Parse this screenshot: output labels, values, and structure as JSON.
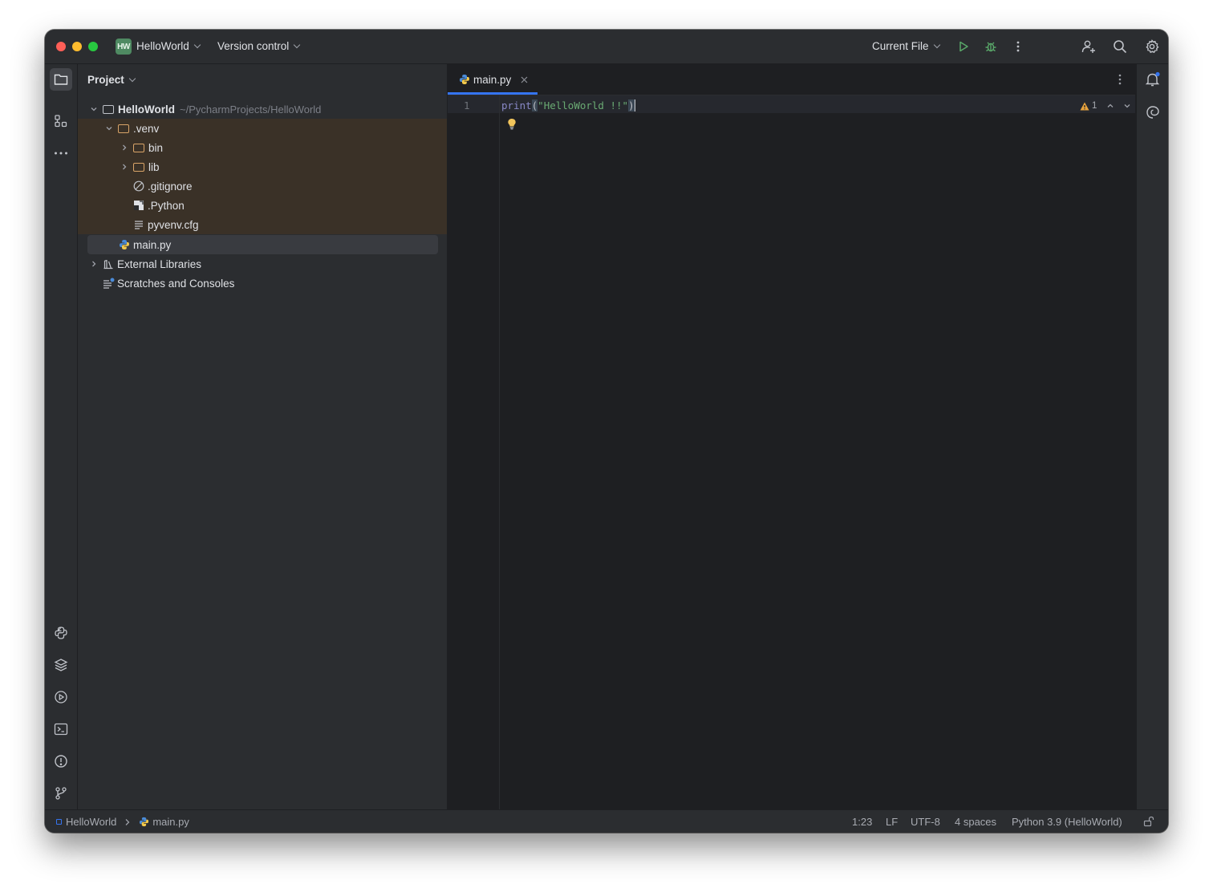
{
  "titlebar": {
    "project_badge": "HW",
    "project_name": "HelloWorld",
    "vcs_label": "Version control",
    "run_config": "Current File"
  },
  "left_tools": [
    "project-folder-icon",
    "structure-icon",
    "more-icon",
    "python-console-icon",
    "python-packages-icon",
    "services-icon",
    "terminal-icon",
    "problems-icon",
    "git-icon"
  ],
  "project_panel": {
    "title": "Project",
    "tree": {
      "root": {
        "name": "HelloWorld",
        "path": "~/PycharmProjects/HelloWorld"
      },
      "venv": ".venv",
      "bin": "bin",
      "lib": "lib",
      "gitignore": ".gitignore",
      "python": ".Python",
      "pyvenv": "pyvenv.cfg",
      "main": "main.py",
      "external": "External Libraries",
      "scratches": "Scratches and Consoles"
    }
  },
  "editor": {
    "tab_label": "main.py",
    "line_number": "1",
    "code": {
      "fn": "print",
      "open": "(",
      "str": "\"HelloWorld !!\"",
      "close": ")"
    },
    "warning_count": "1"
  },
  "statusbar": {
    "breadcrumb_project": "HelloWorld",
    "breadcrumb_file": "main.py",
    "position": "1:23",
    "line_sep": "LF",
    "encoding": "UTF-8",
    "indent": "4 spaces",
    "interpreter": "Python 3.9 (HelloWorld)"
  },
  "colors": {
    "accent": "#3574f0",
    "run_green": "#59a869",
    "venv_highlight": "#3a3127",
    "warning": "#e8a33d"
  }
}
